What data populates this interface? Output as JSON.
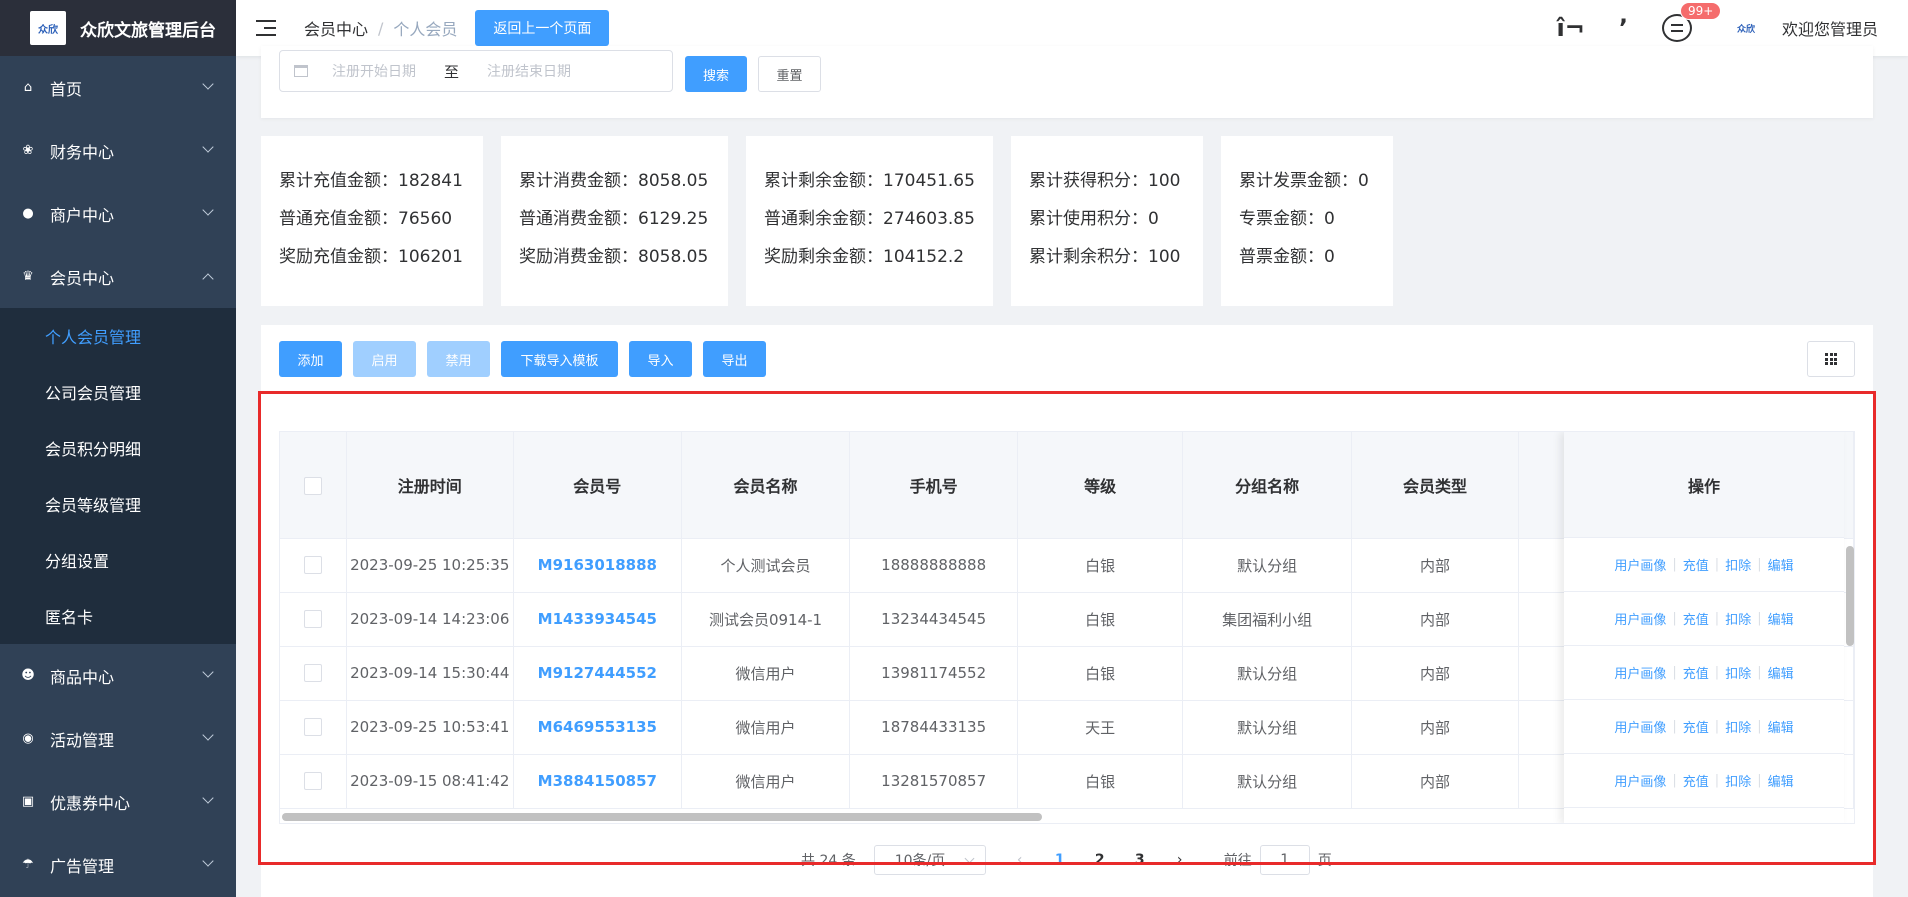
{
  "app": {
    "title": "众欣文旅管理后台",
    "logo_text": "众欣"
  },
  "sidebar": {
    "menus": [
      {
        "label": "首页",
        "icon": "home-icon"
      },
      {
        "label": "财务中心",
        "icon": "money-bag-icon"
      },
      {
        "label": "商户中心",
        "icon": "store-icon"
      },
      {
        "label": "会员中心",
        "icon": "crown-icon",
        "expanded": true
      }
    ],
    "sub_items": [
      "个人会员管理",
      "公司会员管理",
      "会员积分明细",
      "会员等级管理",
      "分组设置",
      "匿名卡"
    ],
    "menus_after": [
      {
        "label": "商品中心",
        "icon": "goods-icon"
      },
      {
        "label": "活动管理",
        "icon": "activity-icon"
      },
      {
        "label": "优惠券中心",
        "icon": "coupon-icon"
      },
      {
        "label": "广告管理",
        "icon": "ad-icon"
      }
    ]
  },
  "header": {
    "breadcrumb": [
      "会员中心",
      "个人会员"
    ],
    "back_button": "返回上一个页面",
    "fullscreen_glyph": "î¬",
    "pin_glyph": "ʼ",
    "badge": "99+",
    "welcome": "欢迎您管理员"
  },
  "search": {
    "start_placeholder": "注册开始日期",
    "to": "至",
    "end_placeholder": "注册结束日期",
    "search_label": "搜索",
    "reset_label": "重置"
  },
  "stats": [
    [
      "累计充值金额：182841",
      "普通充值金额：76560",
      "奖励充值金额：106201"
    ],
    [
      "累计消费金额：8058.05",
      "普通消费金额：6129.25",
      "奖励消费金额：8058.05"
    ],
    [
      "累计剩余金额：170451.65",
      "普通剩余金额：274603.85",
      "奖励剩余金额：104152.2"
    ],
    [
      "累计获得积分：100",
      "累计使用积分：0",
      "累计剩余积分：100"
    ],
    [
      "累计发票金额：0",
      "专票金额：0",
      "普票金额：0"
    ]
  ],
  "toolbar": {
    "add": "添加",
    "enable": "启用",
    "disable": "禁用",
    "download_template": "下载导入模板",
    "import": "导入",
    "export": "导出"
  },
  "table": {
    "headers": [
      "注册时间",
      "会员号",
      "会员名称",
      "手机号",
      "等级",
      "分组名称",
      "会员类型"
    ],
    "op_header": "操作",
    "ops": [
      "用户画像",
      "充值",
      "扣除",
      "编辑"
    ],
    "rows": [
      [
        "2023-09-25 10:25:35",
        "M9163018888",
        "个人测试会员",
        "18888888888",
        "白银",
        "默认分组",
        "内部"
      ],
      [
        "2023-09-14 14:23:06",
        "M1433934545",
        "测试会员0914-1",
        "13234434545",
        "白银",
        "集团福利小组",
        "内部"
      ],
      [
        "2023-09-14 15:30:44",
        "M9127444552",
        "微信用户",
        "13981174552",
        "白银",
        "默认分组",
        "内部"
      ],
      [
        "2023-09-25 10:53:41",
        "M6469553135",
        "微信用户",
        "18784433135",
        "天王",
        "默认分组",
        "内部"
      ],
      [
        "2023-09-15 08:41:42",
        "M3884150857",
        "微信用户",
        "13281570857",
        "白银",
        "默认分组",
        "内部"
      ]
    ]
  },
  "pager": {
    "total": "共 24 条",
    "page_size": "10条/页",
    "pages": [
      "1",
      "2",
      "3"
    ],
    "goto": "前往",
    "goto_value": "1",
    "page_unit": "页"
  },
  "colors": {
    "primary": "#409eff",
    "sidebar": "#304156",
    "highlight": "#e82a2a"
  }
}
